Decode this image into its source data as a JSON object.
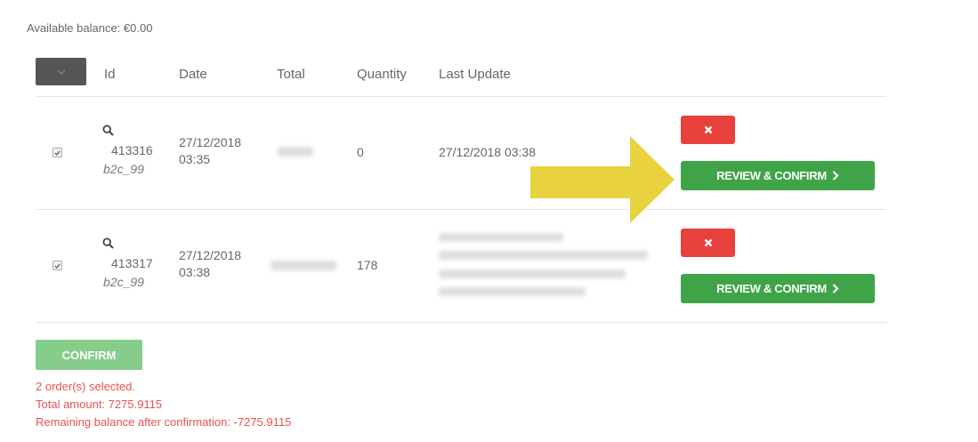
{
  "balance": {
    "text": "Available balance: €0.00"
  },
  "header": {
    "columns": {
      "id": "Id",
      "date": "Date",
      "total": "Total",
      "quantity": "Quantity",
      "last_update": "Last Update"
    }
  },
  "orders": [
    {
      "id": "413316",
      "user": "b2c_99",
      "date_line1": "27/12/2018",
      "date_line2": "03:35",
      "quantity": "0",
      "last_update": "27/12/2018 03:38",
      "checked": true,
      "review_label": "REVIEW & CONFIRM"
    },
    {
      "id": "413317",
      "user": "b2c_99",
      "date_line1": "27/12/2018",
      "date_line2": "03:38",
      "quantity": "178",
      "checked": true,
      "review_label": "REVIEW & CONFIRM"
    }
  ],
  "actions": {
    "confirm_label": "CONFIRM"
  },
  "summary": {
    "selected": "2 order(s) selected.",
    "total": "Total amount: 7275.9115",
    "remaining": "Remaining balance after confirmation: -7275.9115"
  },
  "colors": {
    "delete": "#e8403b",
    "review": "#3fa447",
    "confirm": "#86cd8b",
    "arrow": "#e8d33f",
    "summary_text": "#e55353"
  },
  "icons": {
    "search": "magnifier-icon",
    "delete": "close-icon",
    "review": "chevron-right-icon",
    "bulk": "chevron-down-icon"
  }
}
